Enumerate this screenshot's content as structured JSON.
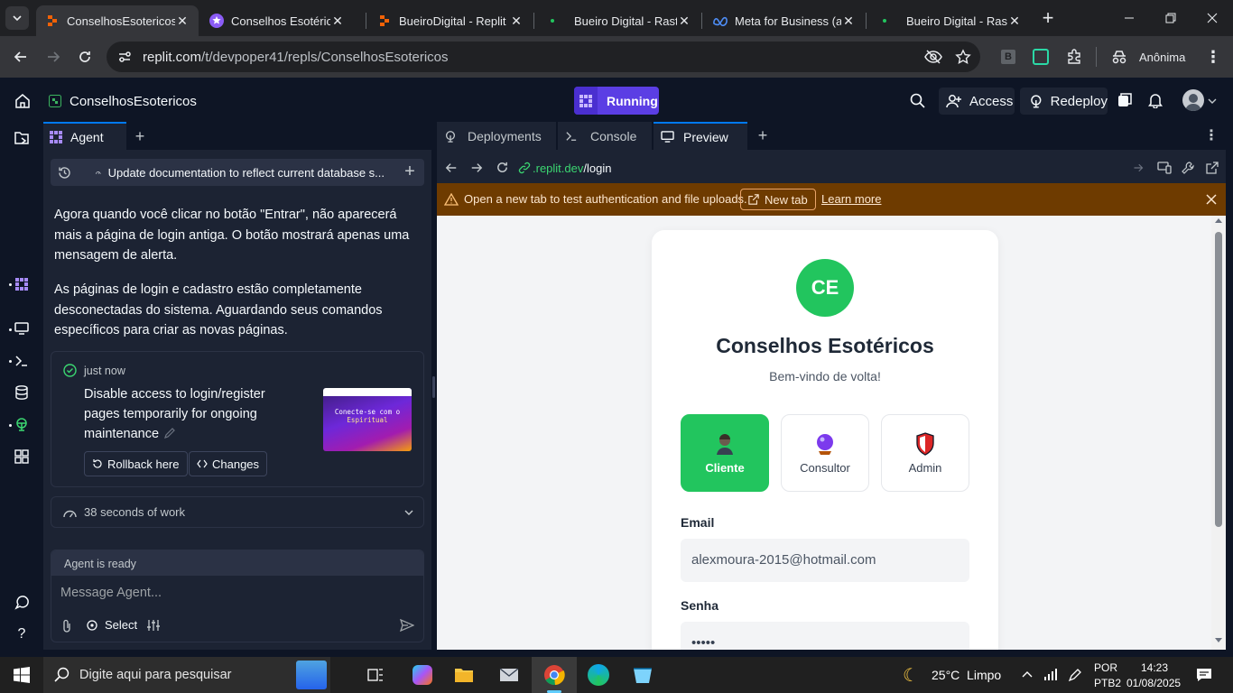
{
  "browser": {
    "tabs": [
      {
        "title": "ConselhosEsotericos -",
        "active": true,
        "favicon": "replit-icon"
      },
      {
        "title": "Conselhos Esotéricos",
        "active": false,
        "favicon": "star-purple-icon"
      },
      {
        "title": "BueiroDigital - Replit",
        "active": false,
        "favicon": "replit-icon"
      },
      {
        "title": "Bueiro Digital - Rastre",
        "active": false,
        "favicon": "dot-green-icon"
      },
      {
        "title": "Meta for Business (an",
        "active": false,
        "favicon": "meta-icon"
      },
      {
        "title": "Bueiro Digital - Rastre",
        "active": false,
        "favicon": "dot-green-icon"
      }
    ],
    "url_host": "replit.com",
    "url_path": "/t/devpoper41/repls/ConselhosEsotericos",
    "profile_label": "Anônima",
    "ext_b_label": "B"
  },
  "replit": {
    "project_name": "ConselhosEsotericos",
    "status": "Running",
    "access_label": "Access",
    "redeploy_label": "Redeploy"
  },
  "agent": {
    "tab_label": "Agent",
    "thread_title": "Update documentation to reflect current database s...",
    "paragraph1": "Agora quando você clicar no botão \"Entrar\", não aparecerá mais a página de login antiga. O botão mostrará apenas uma mensagem de alerta.",
    "paragraph2": "As páginas de login e cadastro estão completamente desconectadas do sistema. Aguardando seus comandos específicos para criar as novas páginas.",
    "checkpoint": {
      "time": "just now",
      "description": "Disable access to login/register pages temporarily for ongoing maintenance",
      "rollback_label": "Rollback here",
      "changes_label": "Changes",
      "thumb_line1": "Conecte-se com o",
      "thumb_line2": "Espiritual"
    },
    "work_summary": "38 seconds of work",
    "status": "Agent is ready",
    "input_placeholder": "Message Agent...",
    "select_label": "Select"
  },
  "right": {
    "tabs": [
      "Deployments",
      "Console",
      "Preview"
    ],
    "preview_url_host": ".replit.dev",
    "preview_url_path": "/login",
    "banner_text": "Open a new tab to test authentication and file uploads.",
    "banner_button": "New tab",
    "banner_link": "Learn more"
  },
  "login": {
    "logo_initials": "CE",
    "title": "Conselhos Esotéricos",
    "subtitle": "Bem-vindo de volta!",
    "roles": [
      {
        "label": "Cliente",
        "selected": true
      },
      {
        "label": "Consultor",
        "selected": false
      },
      {
        "label": "Admin",
        "selected": false
      }
    ],
    "email_label": "Email",
    "email_value": "alexmoura-2015@hotmail.com",
    "password_label": "Senha",
    "password_value": "•••••",
    "accent": "#22c55e"
  },
  "taskbar": {
    "search_placeholder": "Digite aqui para pesquisar",
    "weather": "25°C  Limpo",
    "lang1": "POR",
    "lang2": "PTB2",
    "time": "14:23",
    "date": "01/08/2025"
  }
}
